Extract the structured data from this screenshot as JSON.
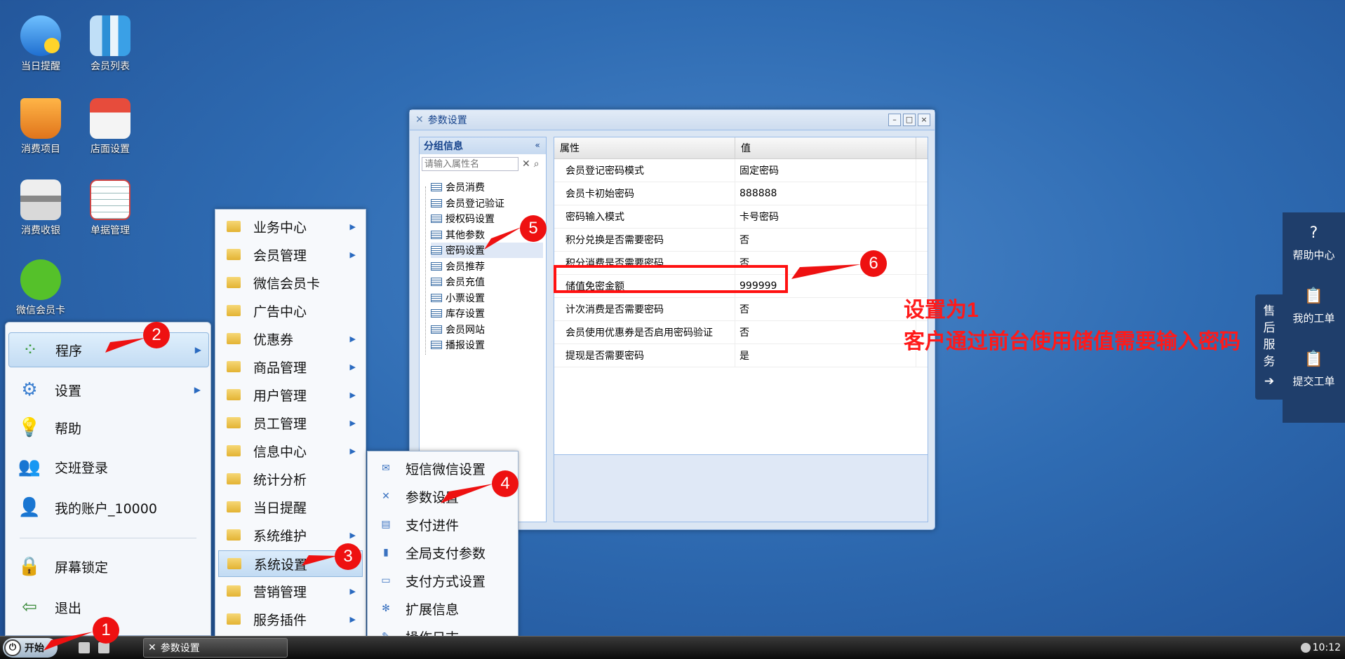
{
  "desktop": {
    "icons": [
      {
        "label": "当日提醒",
        "icon": "reminder-icon"
      },
      {
        "label": "会员列表",
        "icon": "member-list-icon"
      },
      {
        "label": "消费项目",
        "icon": "basket-icon"
      },
      {
        "label": "店面设置",
        "icon": "shop-icon"
      },
      {
        "label": "消费收银",
        "icon": "cash-register-icon"
      },
      {
        "label": "单据管理",
        "icon": "document-icon"
      },
      {
        "label": "微信会员卡",
        "icon": "wechat-icon"
      }
    ]
  },
  "start_menu": {
    "items": [
      {
        "label": "程序",
        "icon": "programs-icon",
        "has_sub": true
      },
      {
        "label": "设置",
        "icon": "gear-icon",
        "has_sub": true
      },
      {
        "label": "帮助",
        "icon": "lightbulb-icon"
      },
      {
        "label": "交班登录",
        "icon": "users-icon"
      },
      {
        "label": "我的账户_10000",
        "icon": "user-icon"
      },
      {
        "label": "屏幕锁定",
        "icon": "lock-icon"
      },
      {
        "label": "退出",
        "icon": "exit-icon"
      }
    ]
  },
  "programs_menu": {
    "items": [
      {
        "label": "业务中心",
        "has_sub": true
      },
      {
        "label": "会员管理",
        "has_sub": true
      },
      {
        "label": "微信会员卡",
        "has_sub": false
      },
      {
        "label": "广告中心",
        "has_sub": false
      },
      {
        "label": "优惠券",
        "has_sub": true
      },
      {
        "label": "商品管理",
        "has_sub": true
      },
      {
        "label": "用户管理",
        "has_sub": true
      },
      {
        "label": "员工管理",
        "has_sub": true
      },
      {
        "label": "信息中心",
        "has_sub": true
      },
      {
        "label": "统计分析",
        "has_sub": false
      },
      {
        "label": "当日提醒",
        "has_sub": false
      },
      {
        "label": "系统维护",
        "has_sub": true
      },
      {
        "label": "系统设置",
        "has_sub": false
      },
      {
        "label": "营销管理",
        "has_sub": true
      },
      {
        "label": "服务插件",
        "has_sub": true
      }
    ]
  },
  "settings_menu": {
    "items": [
      {
        "label": "短信微信设置",
        "icon": "sms-icon"
      },
      {
        "label": "参数设置",
        "icon": "tools-icon"
      },
      {
        "label": "支付进件",
        "icon": "payment-apply-icon"
      },
      {
        "label": "全局支付参数",
        "icon": "phone-icon"
      },
      {
        "label": "支付方式设置",
        "icon": "card-icon"
      },
      {
        "label": "扩展信息",
        "icon": "extension-icon"
      },
      {
        "label": "操作日志",
        "icon": "log-icon"
      }
    ]
  },
  "window": {
    "title": "参数设置",
    "left_panel": {
      "title": "分组信息",
      "search_placeholder": "请输入属性名",
      "tree": [
        "会员消费",
        "会员登记验证",
        "授权码设置",
        "其他参数",
        "密码设置",
        "会员推荐",
        "会员充值",
        "小票设置",
        "库存设置",
        "会员网站",
        "播报设置"
      ],
      "selected": "密码设置"
    },
    "grid": {
      "headers": [
        "属性",
        "值"
      ],
      "rows": [
        {
          "prop": "会员登记密码模式",
          "value": "固定密码"
        },
        {
          "prop": "会员卡初始密码",
          "value": "888888"
        },
        {
          "prop": "密码输入模式",
          "value": "卡号密码"
        },
        {
          "prop": "积分兑换是否需要密码",
          "value": "否"
        },
        {
          "prop": "积分消费是否需要密码",
          "value": "否"
        },
        {
          "prop": "储值免密金额",
          "value": "999999"
        },
        {
          "prop": "计次消费是否需要密码",
          "value": "否"
        },
        {
          "prop": "会员使用优惠券是否启用密码验证",
          "value": "否"
        },
        {
          "prop": "提现是否需要密码",
          "value": "是"
        }
      ]
    }
  },
  "side_panel": {
    "tab_label": "售后服务",
    "items": [
      {
        "label": "帮助中心",
        "icon": "question-icon"
      },
      {
        "label": "我的工单",
        "icon": "clipboard-icon"
      },
      {
        "label": "提交工单",
        "icon": "submit-clipboard-icon"
      }
    ]
  },
  "taskbar": {
    "start_label": "开始",
    "task_label": "参数设置",
    "clock": "10:12"
  },
  "annotations": {
    "note_line1": "设置为1",
    "note_line2": "客户通过前台使用储值需要输入密码",
    "markers": [
      "1",
      "2",
      "3",
      "4",
      "5",
      "6"
    ],
    "color": "#ff1111"
  }
}
